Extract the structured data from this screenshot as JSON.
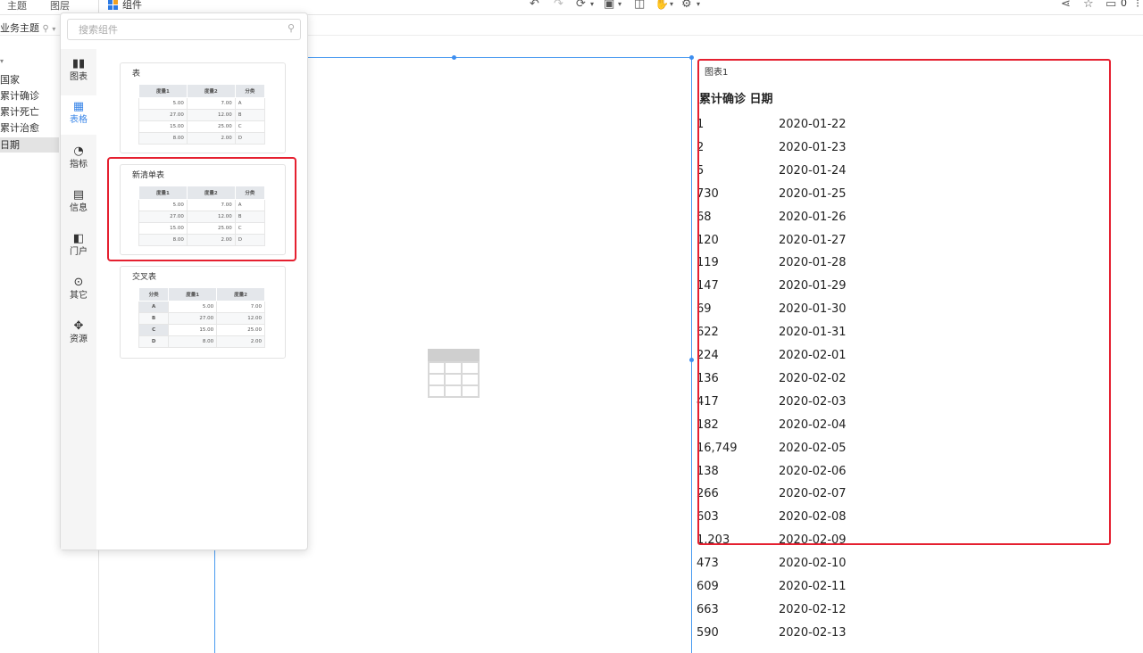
{
  "top_tabs": [
    "主题",
    "图层"
  ],
  "component_tab": "组件",
  "toolbar": {
    "share_count": "0"
  },
  "left_panel": {
    "business_select": "业务主题",
    "fields": [
      "国家",
      "累计确诊",
      "累计死亡",
      "累计治愈",
      "日期"
    ]
  },
  "popup": {
    "search_placeholder": "搜索组件",
    "categories": [
      {
        "label": "图表",
        "icon": "bar-chart-icon"
      },
      {
        "label": "表格",
        "icon": "table-icon"
      },
      {
        "label": "指标",
        "icon": "gauge-icon"
      },
      {
        "label": "信息",
        "icon": "info-icon"
      },
      {
        "label": "门户",
        "icon": "portal-icon"
      },
      {
        "label": "其它",
        "icon": "more-icon"
      },
      {
        "label": "资源",
        "icon": "puzzle-icon"
      }
    ],
    "cards": [
      {
        "title": "表",
        "headers": [
          "度量1",
          "度量2",
          "分类"
        ],
        "rows": [
          [
            "5.00",
            "7.00",
            "A"
          ],
          [
            "27.00",
            "12.00",
            "B"
          ],
          [
            "15.00",
            "25.00",
            "C"
          ],
          [
            "8.00",
            "2.00",
            "D"
          ]
        ]
      },
      {
        "title": "新清单表",
        "headers": [
          "度量1",
          "度量2",
          "分类"
        ],
        "rows": [
          [
            "5.00",
            "7.00",
            "A"
          ],
          [
            "27.00",
            "12.00",
            "B"
          ],
          [
            "15.00",
            "25.00",
            "C"
          ],
          [
            "8.00",
            "2.00",
            "D"
          ]
        ]
      },
      {
        "title": "交叉表",
        "headers": [
          "分类",
          "度量1",
          "度量2"
        ],
        "rows": [
          [
            "A",
            "5.00",
            "7.00"
          ],
          [
            "B",
            "27.00",
            "12.00"
          ],
          [
            "C",
            "15.00",
            "25.00"
          ],
          [
            "D",
            "8.00",
            "2.00"
          ]
        ]
      }
    ]
  },
  "chart": {
    "title": "图表1",
    "header": "累计确诊 日期",
    "rows": [
      {
        "count": "1",
        "date": "2020-01-22"
      },
      {
        "count": "2",
        "date": "2020-01-23"
      },
      {
        "count": "5",
        "date": "2020-01-24"
      },
      {
        "count": "730",
        "date": "2020-01-25"
      },
      {
        "count": "68",
        "date": "2020-01-26"
      },
      {
        "count": "120",
        "date": "2020-01-27"
      },
      {
        "count": "119",
        "date": "2020-01-28"
      },
      {
        "count": "147",
        "date": "2020-01-29"
      },
      {
        "count": "69",
        "date": "2020-01-30"
      },
      {
        "count": "622",
        "date": "2020-01-31"
      },
      {
        "count": "224",
        "date": "2020-02-01"
      },
      {
        "count": "136",
        "date": "2020-02-02"
      },
      {
        "count": "417",
        "date": "2020-02-03"
      },
      {
        "count": "182",
        "date": "2020-02-04"
      },
      {
        "count": "16,749",
        "date": "2020-02-05"
      },
      {
        "count": "138",
        "date": "2020-02-06"
      },
      {
        "count": "266",
        "date": "2020-02-07"
      },
      {
        "count": "603",
        "date": "2020-02-08"
      },
      {
        "count": "1,203",
        "date": "2020-02-09"
      },
      {
        "count": "473",
        "date": "2020-02-10"
      },
      {
        "count": "609",
        "date": "2020-02-11"
      },
      {
        "count": "663",
        "date": "2020-02-12"
      },
      {
        "count": "590",
        "date": "2020-02-13"
      }
    ]
  },
  "colors": {
    "accent": "#3a86e8",
    "highlight": "#e52030"
  }
}
